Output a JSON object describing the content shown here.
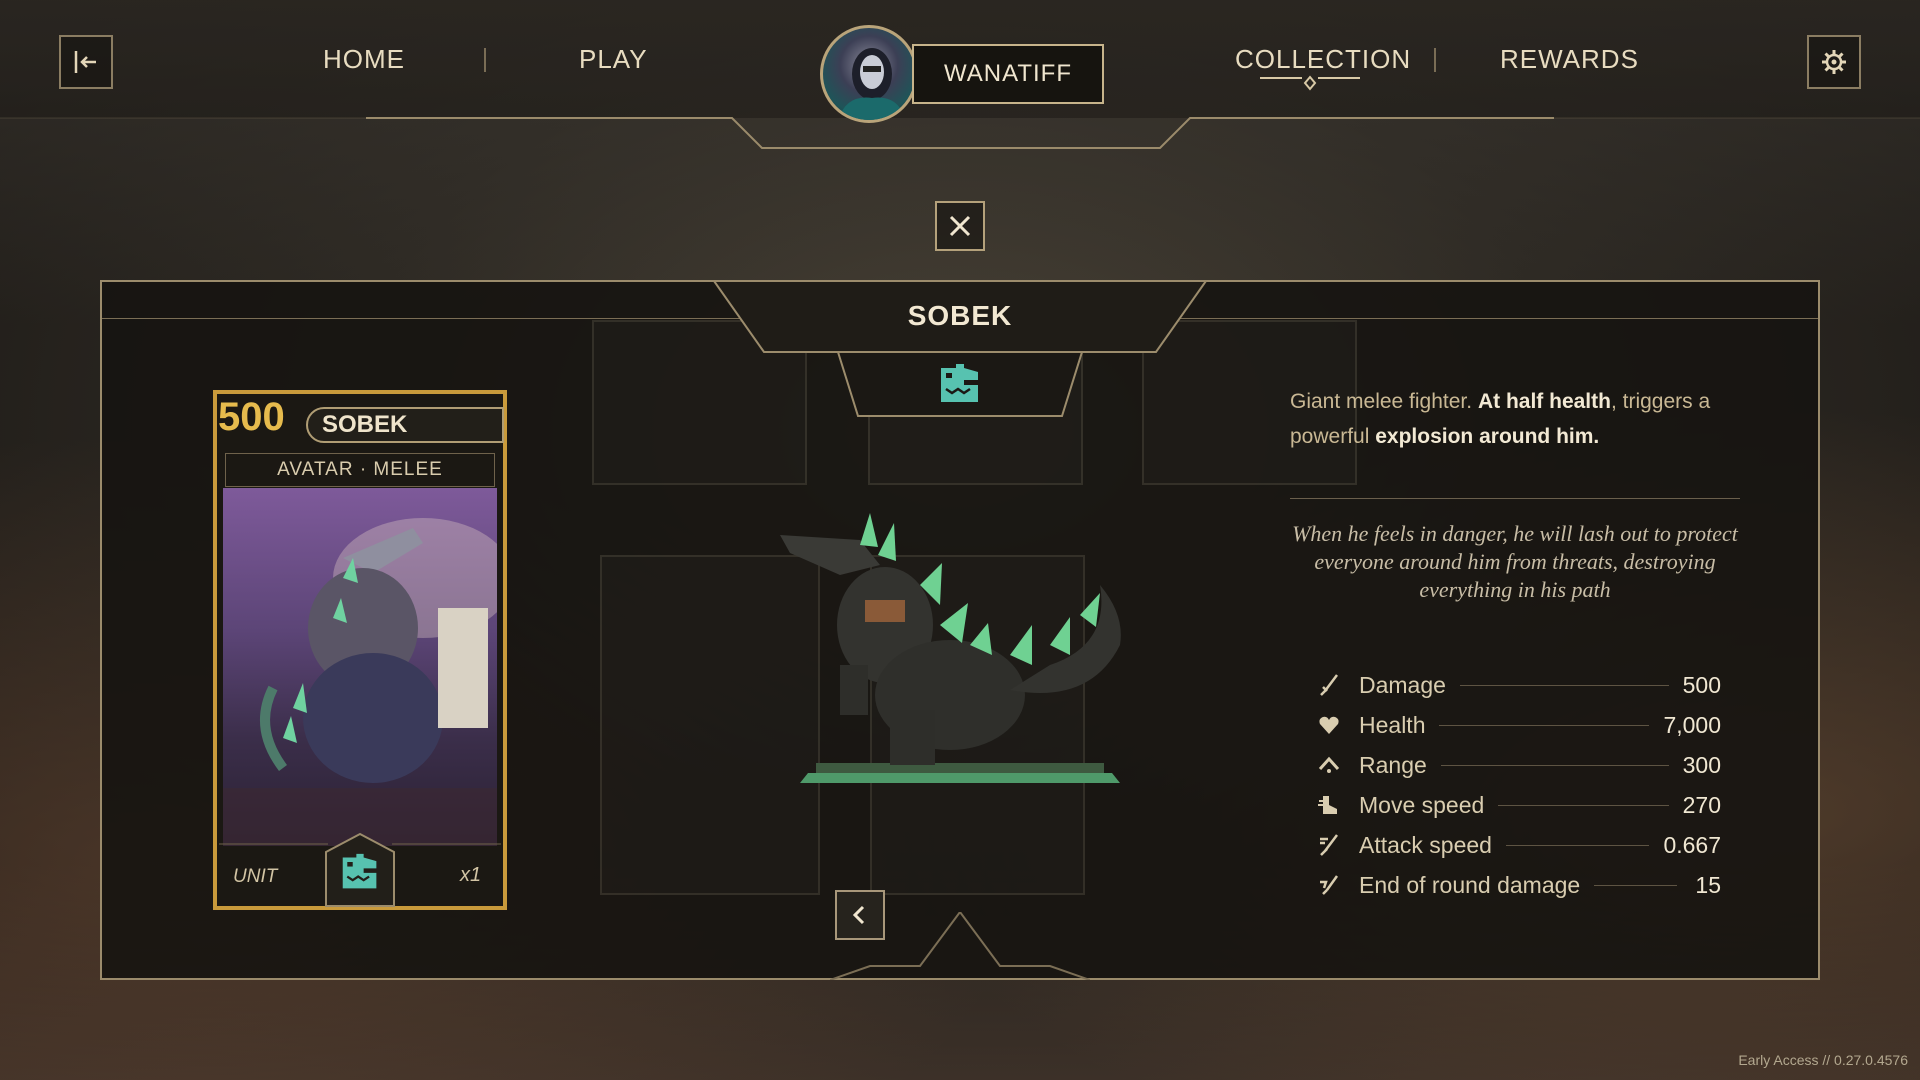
{
  "nav": {
    "exit_icon": "exit-icon",
    "home": "HOME",
    "play": "PLAY",
    "collection": "COLLECTION",
    "rewards": "REWARDS",
    "settings_icon": "gear-icon",
    "active": "COLLECTION"
  },
  "player": {
    "username": "WANATIFF",
    "avatar_icon": "player-avatar"
  },
  "detail": {
    "title": "SOBEK",
    "close_icon": "close-icon",
    "faction_icon": "crocodile-icon",
    "back_icon": "chevron-left-icon"
  },
  "card": {
    "cost": "500",
    "name": "SOBEK",
    "type_line": "AVATAR · MELEE",
    "footer_type": "UNIT",
    "count": "x1"
  },
  "description": {
    "p1": "Giant melee fighter.",
    "p2": "At half health",
    "p3": ", triggers a powerful",
    "p4": "explosion around him."
  },
  "flavor": "When he feels in danger, he will lash out to protect everyone around him from threats, destroying everything in his path",
  "stats": [
    {
      "label": "Damage",
      "value": "500",
      "icon": "sword-icon"
    },
    {
      "label": "Health",
      "value": "7,000",
      "icon": "heart-icon"
    },
    {
      "label": "Range",
      "value": "300",
      "icon": "range-icon"
    },
    {
      "label": "Move speed",
      "value": "270",
      "icon": "boot-icon"
    },
    {
      "label": "Attack speed",
      "value": "0.667",
      "icon": "attack-speed-icon"
    },
    {
      "label": "End of round damage",
      "value": "15",
      "icon": "end-round-damage-icon"
    }
  ],
  "footer": {
    "version": "Early Access // 0.27.0.4576"
  },
  "colors": {
    "gold": "#c99a3b",
    "accent_teal": "#58c7b5",
    "text": "#e8dcc0"
  }
}
